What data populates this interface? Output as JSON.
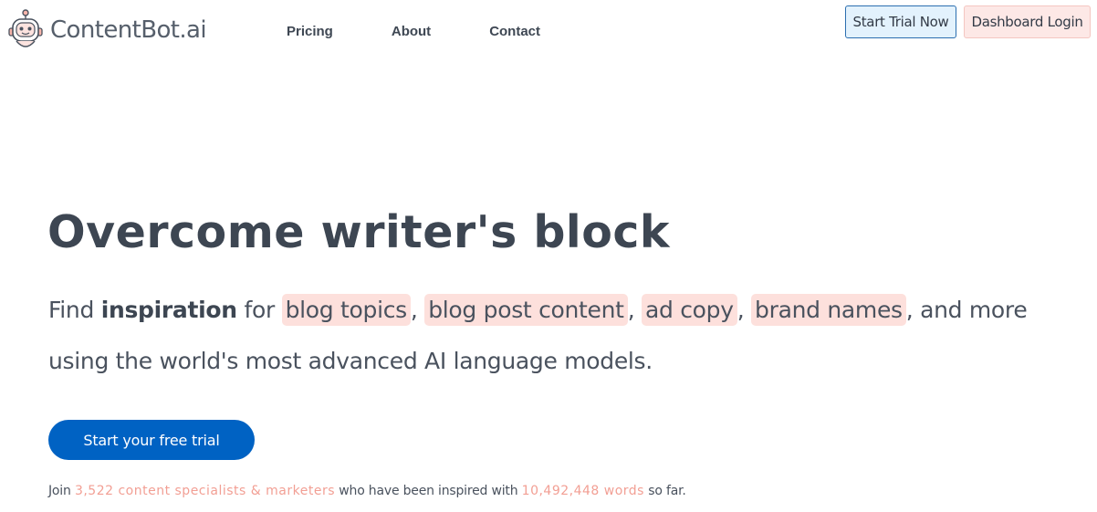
{
  "brand": {
    "name": "ContentBot.ai",
    "logo_icon": "robot-icon"
  },
  "nav": {
    "items": [
      "Pricing",
      "About",
      "Contact"
    ]
  },
  "header_buttons": {
    "trial": "Start Trial Now",
    "login": "Dashboard Login"
  },
  "hero": {
    "title": "Overcome writer's block",
    "sub_find": "Find",
    "sub_bold": "inspiration",
    "sub_for": "for",
    "highlights": [
      "blog topics",
      "blog post content",
      "ad copy",
      "brand names"
    ],
    "sub_end": ", and more using the world's most advanced AI language models."
  },
  "cta": {
    "label": "Start your free trial"
  },
  "stats": {
    "prefix": "Join",
    "specialists": "3,522 content specialists & marketers",
    "middle": "who have been inspired with",
    "words": "10,492,448 words",
    "suffix": "so far."
  },
  "colors": {
    "accent": "#f29f94",
    "primary_button": "#0062c3",
    "highlight_bg": "#fde0dc"
  }
}
